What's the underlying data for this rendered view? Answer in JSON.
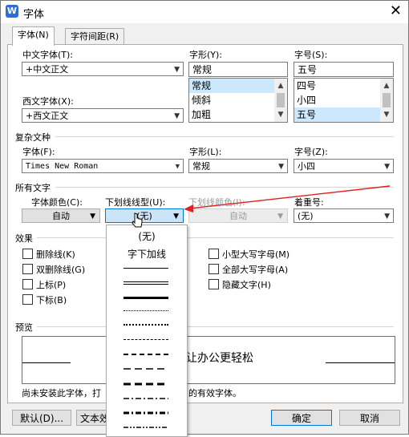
{
  "window": {
    "title": "字体",
    "app_icon": "W"
  },
  "tabs": [
    {
      "label": "字体(N)"
    },
    {
      "label": "字符间距(R)"
    }
  ],
  "chinese_font": {
    "label": "中文字体(T):",
    "value": "+中文正文"
  },
  "western_font": {
    "label": "西文字体(X):",
    "value": "+西文正文"
  },
  "font_style": {
    "label": "字形(Y):",
    "value": "常规",
    "items": [
      "常规",
      "倾斜",
      "加粗"
    ]
  },
  "font_size": {
    "label": "字号(S):",
    "value": "五号",
    "items": [
      "四号",
      "小四",
      "五号"
    ]
  },
  "complex": {
    "section": "复杂文种",
    "font_label": "字体(F):",
    "font_value": "Times New Roman",
    "style_label": "字形(L):",
    "style_value": "常规",
    "size_label": "字号(Z):",
    "size_value": "小四"
  },
  "all_text": {
    "section": "所有文字",
    "color_label": "字体颜色(C):",
    "color_value": "自动",
    "underline_label": "下划线线型(U):",
    "underline_value": "(无)",
    "underline_color_label": "下划线颜色(I):",
    "underline_color_value": "自动",
    "emphasis_label": "着重号:",
    "emphasis_value": "(无)"
  },
  "effects": {
    "section": "效果",
    "strikethrough": "删除线(K)",
    "double_strike": "双删除线(G)",
    "superscript": "上标(P)",
    "subscript": "下标(B)",
    "small_caps": "小型大写字母(M)",
    "all_caps": "全部大写字母(A)",
    "hidden": "隐藏文字(H)"
  },
  "preview": {
    "section": "预览",
    "sample": "让办公更轻松",
    "note_start": "尚未安装此字体，打",
    "note_end": "的有效字体。"
  },
  "underline_popup": {
    "items": [
      "(无)",
      "字下加线"
    ]
  },
  "buttons": {
    "default": "默认(D)...",
    "text_effects": "文本效",
    "ok": "确定",
    "cancel": "取消"
  },
  "colors": {
    "accent": "#0078d7",
    "selection": "#cce8ff",
    "arrow": "#e02020"
  }
}
